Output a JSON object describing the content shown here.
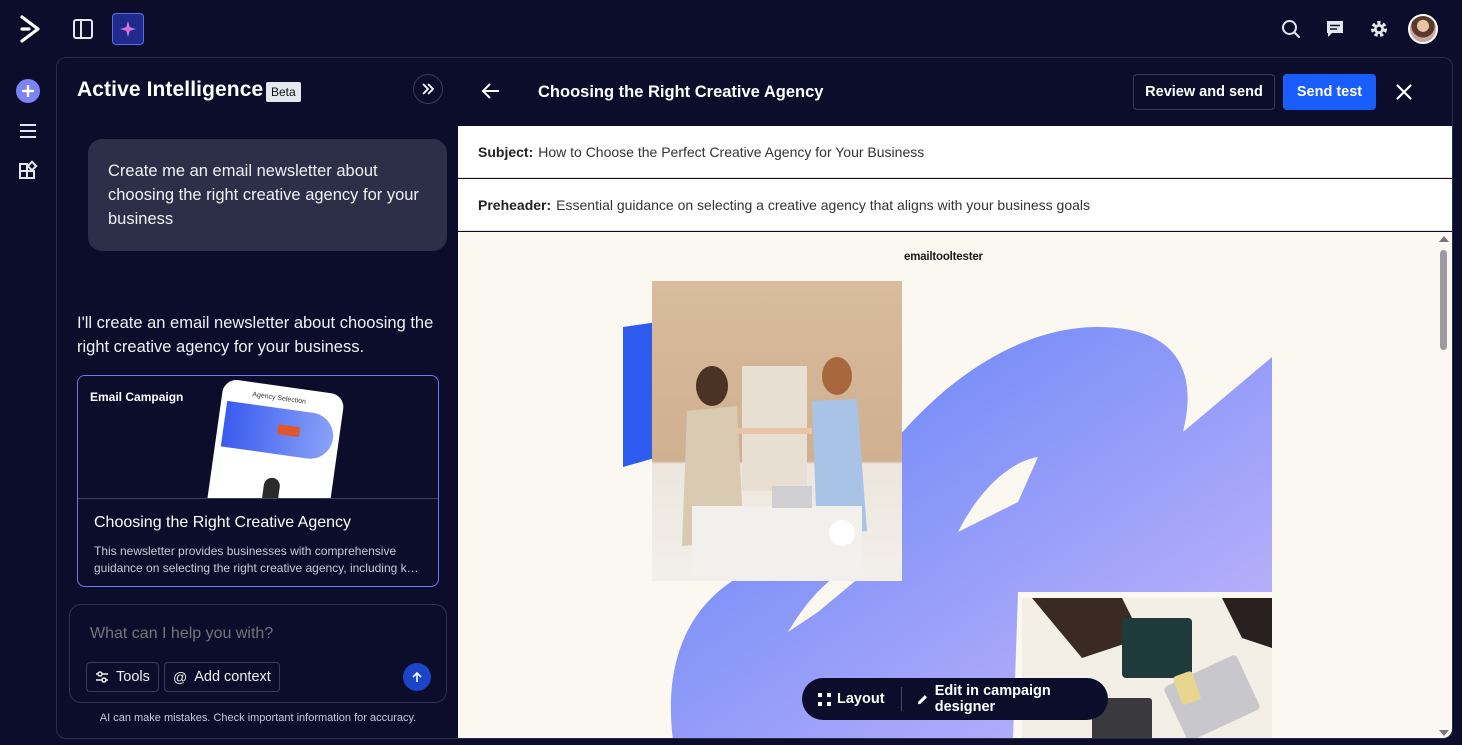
{
  "colors": {
    "background": "#0b0d2b",
    "accent": "#1a5dff",
    "card_border": "#6b7bf5",
    "user_bubble": "#2d2f48",
    "email_bg": "#fbf8f2"
  },
  "topbar": {
    "icons": [
      "app-logo-icon",
      "sidebar-toggle-icon",
      "ai-sparkle-icon",
      "search-icon",
      "chat-icon",
      "gear-icon",
      "avatar"
    ]
  },
  "rail": {
    "icons": [
      "add-icon",
      "menu-icon",
      "apps-icon"
    ]
  },
  "ai_panel": {
    "title": "Active Intelligence",
    "badge": "Beta",
    "user_message": "Create me an email newsletter about choosing the right creative agency for your business",
    "ai_reply": "I'll create an email newsletter about choosing the right creative agency for your business.",
    "card": {
      "label": "Email Campaign",
      "phone_title": "Agency Selection",
      "title": "Choosing the Right Creative Agency",
      "description": "This newsletter provides businesses with comprehensive guidance on selecting the right creative agency, including k…"
    },
    "composer": {
      "placeholder": "What can I help you with?",
      "tools_label": "Tools",
      "add_context_label": "Add context"
    },
    "disclaimer": "AI can make mistakes. Check important information for accuracy."
  },
  "preview": {
    "title": "Choosing the Right Creative Agency",
    "review_label": "Review and send",
    "send_test_label": "Send test",
    "subject_label": "Subject:",
    "subject_value": "How to Choose the Perfect Creative Agency for Your Business",
    "preheader_label": "Preheader:",
    "preheader_value": "Essential guidance on selecting a creative agency that aligns with your business goals",
    "brand_prefix": "emailtooltester",
    "brand_suffix": "",
    "toolbar": {
      "layout_label": "Layout",
      "edit_label": "Edit in campaign designer"
    }
  }
}
